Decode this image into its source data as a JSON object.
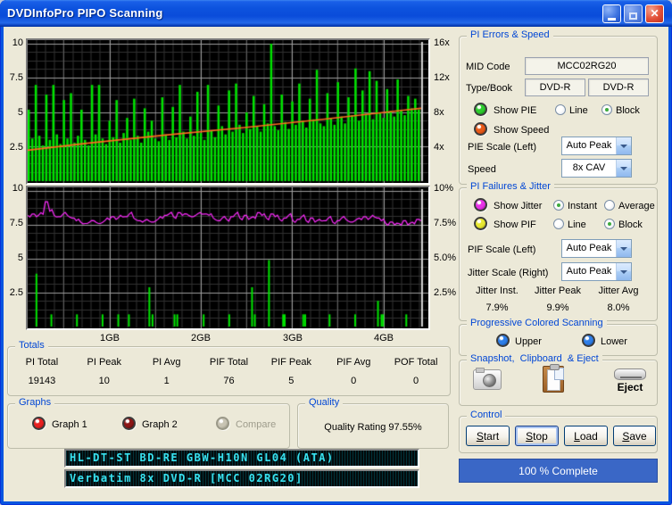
{
  "window": {
    "title": "DVDInfoPro PIPO Scanning",
    "close_glyph": "✕"
  },
  "colors": {
    "window_bg": "#ECE9D8",
    "titlebar_blue": "#0D53DE",
    "group_label": "#0046D5",
    "pie_green": "#00E400",
    "speed_orange": "#FF6B20",
    "jitter_magenta": "#FF2BFF",
    "pif_green": "#00E400",
    "progress_blue": "#3A67C6",
    "lcd_cyan": "#38E2F0"
  },
  "chart_data": [
    {
      "type": "bar",
      "title": "PIE errors with speed overlay",
      "left_ticks": [
        "10",
        "7.5",
        "5",
        "2.5"
      ],
      "right_ticks": [
        "16x",
        "12x",
        "8x",
        "4x"
      ],
      "x_ticks": [
        "1GB",
        "2GB",
        "3GB",
        "4GB"
      ],
      "ylim": [
        0,
        10
      ],
      "right_axis_lim": [
        0,
        16
      ],
      "x_tick_fracs": [
        0.205,
        0.433,
        0.661,
        0.889
      ],
      "end_marker_frac": 0.982,
      "grid": {
        "minor": "#323232",
        "half": "#5d5d5d",
        "major": "#9d9d9d"
      },
      "series": [
        {
          "name": "PIE",
          "type": "bars",
          "color": "#00E400",
          "values": [
            5.2,
            3.1,
            7.0,
            3.3,
            2.6,
            6.3,
            3.0,
            7.0,
            3.4,
            2.7,
            5.9,
            3.1,
            6.4,
            2.8,
            3.3,
            5.2,
            3.0,
            2.6,
            7.0,
            3.4,
            7.0,
            3.1,
            2.7,
            4.4,
            3.2,
            5.9,
            2.8,
            3.5,
            4.6,
            3.0,
            6.0,
            3.3,
            2.8,
            5.3,
            3.6,
            4.4,
            3.1,
            2.9,
            6.1,
            3.4,
            3.0,
            5.4,
            3.2,
            7.0,
            3.6,
            3.1,
            4.7,
            3.3,
            6.5,
            3.5,
            3.0,
            7.0,
            3.7,
            3.2,
            5.5,
            4.0,
            3.4,
            6.6,
            3.6,
            7.1,
            4.1,
            3.5,
            5.0,
            3.8,
            6.2,
            4.0,
            3.6,
            5.6,
            4.2,
            10.0,
            4.0,
            3.7,
            6.3,
            4.3,
            3.8,
            5.8,
            4.1,
            7.1,
            4.4,
            3.9,
            6.0,
            4.5,
            8.1,
            4.2,
            4.0,
            6.4,
            4.6,
            4.1,
            7.2,
            4.7,
            4.2,
            6.1,
            4.8,
            8.2,
            4.4,
            6.6,
            4.9,
            8.0,
            4.5,
            7.3,
            5.0,
            4.6,
            6.7,
            5.1,
            4.7,
            7.4,
            5.2,
            4.8,
            6.2,
            5.3,
            6.0,
            5.2
          ]
        },
        {
          "name": "Speed",
          "type": "line",
          "color": "#FF6B20",
          "points": [
            [
              0,
              2.25
            ],
            [
              0.15,
              2.75
            ],
            [
              0.35,
              3.35
            ],
            [
              0.55,
              3.9
            ],
            [
              0.75,
              4.5
            ],
            [
              0.95,
              5.15
            ],
            [
              1,
              5.3
            ]
          ]
        }
      ]
    },
    {
      "type": "line",
      "title": "PIF failures and jitter",
      "left_ticks": [
        "10",
        "7.5",
        "5",
        "2.5"
      ],
      "right_ticks": [
        "10%",
        "7.5%",
        "5.0%",
        "2.5%"
      ],
      "x_ticks": [
        "1GB",
        "2GB",
        "3GB",
        "4GB"
      ],
      "ylim": [
        0,
        10
      ],
      "right_axis_lim": [
        0,
        10
      ],
      "x_tick_fracs": [
        0.205,
        0.433,
        0.661,
        0.889
      ],
      "end_marker_frac": 0.982,
      "grid": {
        "minor": "#323232",
        "half": "#5d5d5d",
        "major": "#9d9d9d"
      },
      "series": [
        {
          "name": "PIF",
          "type": "sparse_bars",
          "color": "#00E400",
          "bars": [
            [
              0.02,
              3.9
            ],
            [
              0.058,
              0.9
            ],
            [
              0.123,
              0.9
            ],
            [
              0.188,
              0.9
            ],
            [
              0.228,
              0.9
            ],
            [
              0.255,
              0.9
            ],
            [
              0.307,
              2.9
            ],
            [
              0.315,
              0.9
            ],
            [
              0.371,
              0.9
            ],
            [
              0.378,
              0.9
            ],
            [
              0.445,
              0.9
            ],
            [
              0.51,
              0.9
            ],
            [
              0.568,
              2.9
            ],
            [
              0.575,
              0.9
            ],
            [
              0.611,
              4.9
            ],
            [
              0.647,
              0.9
            ],
            [
              0.651,
              0.9
            ],
            [
              0.698,
              0.9
            ],
            [
              0.703,
              0.9
            ],
            [
              0.765,
              0.9
            ],
            [
              0.83,
              0.9
            ],
            [
              0.888,
              1.9
            ],
            [
              0.897,
              0.9
            ],
            [
              0.901,
              0.9
            ],
            [
              0.96,
              0.9
            ]
          ]
        },
        {
          "name": "Jitter",
          "type": "line_values",
          "color": "#FF2BFF",
          "values": [
            8.2,
            8.3,
            8.1,
            8.4,
            9.2,
            8.5,
            8.2,
            8.1,
            8.3,
            8.2,
            8.0,
            7.8,
            7.7,
            7.6,
            7.7,
            7.8,
            7.6,
            7.7,
            8.0,
            8.1,
            7.9,
            8.2,
            8.1,
            8.3,
            8.0,
            7.8,
            7.7,
            7.9,
            7.7,
            7.8,
            8.1,
            8.2,
            8.3,
            8.1,
            8.4,
            8.2,
            8.3,
            8.1,
            8.2,
            8.4,
            8.3,
            8.2,
            8.0,
            7.8,
            8.0,
            7.9,
            8.1,
            8.3,
            8.0,
            8.2,
            7.9,
            8.1,
            8.4,
            8.2,
            8.0,
            8.3,
            8.1,
            7.9,
            8.0,
            8.2,
            7.8,
            7.9,
            8.1,
            7.8,
            8.0,
            7.7,
            7.9,
            7.8,
            8.0,
            7.7,
            7.8,
            8.0,
            7.9,
            7.7,
            7.8,
            8.0,
            8.1,
            7.9,
            8.2,
            8.0,
            7.8,
            7.6,
            7.7,
            7.5,
            7.6,
            7.8,
            7.5,
            7.7,
            7.9,
            7.8
          ]
        }
      ]
    }
  ],
  "pi_errors_speed": {
    "label": "PI Errors & Speed",
    "mid_code_label": "MID Code",
    "mid_code_value": "MCC02RG20",
    "type_book_label": "Type/Book",
    "type_value": "DVD-R",
    "book_value": "DVD-R",
    "show_pie": "Show PIE",
    "line": "Line",
    "block": "Block",
    "show_speed": "Show Speed",
    "pie_scale_label": "PIE Scale (Left)",
    "pie_scale_value": "Auto Peak",
    "speed_label": "Speed",
    "speed_value": "8x CAV"
  },
  "pi_failures_jitter": {
    "label": "PI Failures & Jitter",
    "show_jitter": "Show Jitter",
    "instant": "Instant",
    "average": "Average",
    "show_pif": "Show PIF",
    "line": "Line",
    "block": "Block",
    "pif_scale_label": "PIF Scale (Left)",
    "pif_scale_value": "Auto Peak",
    "jitter_scale_label": "Jitter Scale (Right)",
    "jitter_scale_value": "Auto Peak",
    "stats": [
      {
        "label": "Jitter Inst.",
        "value": "7.9%"
      },
      {
        "label": "Jitter Peak",
        "value": "9.9%"
      },
      {
        "label": "Jitter Avg",
        "value": "8.0%"
      }
    ]
  },
  "progressive": {
    "label": "Progressive Colored Scanning",
    "upper": "Upper",
    "lower": "Lower"
  },
  "snapshot": {
    "label": "Snapshot,  Clipboard  & Eject",
    "eject_label": "Eject"
  },
  "control": {
    "label": "Control",
    "buttons": [
      "Start",
      "Stop",
      "Load",
      "Save"
    ]
  },
  "progress": {
    "text": "100 % Complete"
  },
  "totals": {
    "label": "Totals",
    "columns": [
      {
        "label": "PI Total",
        "value": "19143"
      },
      {
        "label": "PI Peak",
        "value": "10"
      },
      {
        "label": "PI Avg",
        "value": "1"
      },
      {
        "label": "PIF Total",
        "value": "76"
      },
      {
        "label": "PIF Peak",
        "value": "5"
      },
      {
        "label": "PIF Avg",
        "value": "0"
      },
      {
        "label": "POF Total",
        "value": "0"
      }
    ]
  },
  "graphs_panel": {
    "label": "Graphs",
    "items": [
      {
        "label": "Graph 1"
      },
      {
        "label": "Graph 2"
      },
      {
        "label": "Compare"
      }
    ]
  },
  "quality": {
    "label": "Quality",
    "text": "Quality Rating 97.55%"
  },
  "lcd": {
    "line1": "HL-DT-ST BD-RE GBW-H10N GL04 (ATA)",
    "line2": "Verbatim 8x DVD-R [MCC 02RG20]"
  },
  "leds": {
    "show_pie": {
      "color": "#2ECC2E",
      "dark": "#0E6E0E"
    },
    "show_speed": {
      "color": "#E85A18",
      "dark": "#8A2A08"
    },
    "show_jitter": {
      "color": "#E832E8",
      "dark": "#881488"
    },
    "show_pif": {
      "color": "#E8E832",
      "dark": "#909010"
    },
    "upper": {
      "color": "#2E7EE8",
      "dark": "#10408C"
    },
    "lower": {
      "color": "#2E7EE8",
      "dark": "#10408C"
    },
    "graph1": {
      "color": "#E82020",
      "dark": "#8C0A0A"
    },
    "graph2": {
      "color": "#8C1616",
      "dark": "#3A0606"
    },
    "compare": {
      "color": "#C8C4B4",
      "dark": "#8A8878"
    }
  }
}
